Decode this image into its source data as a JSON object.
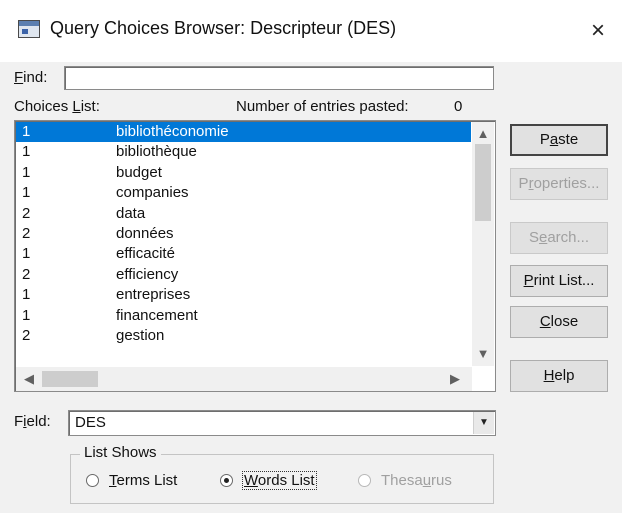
{
  "window": {
    "title": "Query Choices Browser: Descripteur (DES)",
    "close_glyph": "×"
  },
  "find": {
    "label_accel": "F",
    "label_rest": "ind:",
    "value": ""
  },
  "choices": {
    "label_pre": "Choices ",
    "label_accel": "L",
    "label_post": "ist:",
    "entries_pasted_label": "Number of entries pasted:",
    "entries_pasted_value": "0",
    "rows": [
      {
        "count": "1",
        "term": "bibliothéconomie",
        "selected": true
      },
      {
        "count": "1",
        "term": "bibliothèque"
      },
      {
        "count": "1",
        "term": "budget"
      },
      {
        "count": "1",
        "term": "companies"
      },
      {
        "count": "2",
        "term": "data"
      },
      {
        "count": "2",
        "term": "données"
      },
      {
        "count": "1",
        "term": "efficacité"
      },
      {
        "count": "2",
        "term": "efficiency"
      },
      {
        "count": "1",
        "term": "entreprises"
      },
      {
        "count": "1",
        "term": "financement"
      },
      {
        "count": "2",
        "term": "gestion"
      }
    ]
  },
  "buttons": {
    "paste": {
      "pre": "P",
      "accel": "a",
      "post": "ste"
    },
    "properties": {
      "pre": "P",
      "accel": "r",
      "post": "operties..."
    },
    "search": {
      "pre": "S",
      "accel": "e",
      "post": "arch..."
    },
    "print": {
      "pre": "",
      "accel": "P",
      "post": "rint List..."
    },
    "close": {
      "pre": "",
      "accel": "C",
      "post": "lose"
    },
    "help": {
      "pre": "",
      "accel": "H",
      "post": "elp"
    }
  },
  "field": {
    "label_pre": "F",
    "label_accel": "i",
    "label_post": "eld:",
    "value": "DES"
  },
  "list_shows": {
    "title": "List Shows",
    "options": [
      {
        "pre": "",
        "accel": "T",
        "post": "erms List",
        "selected": false,
        "enabled": true
      },
      {
        "pre": "",
        "accel": "W",
        "post": "ords List",
        "selected": true,
        "enabled": true
      },
      {
        "pre": "Thesa",
        "accel": "u",
        "post": "rus",
        "selected": false,
        "enabled": false
      }
    ]
  },
  "icons": [
    "app-icon",
    "close-icon",
    "scroll-up-icon",
    "scroll-down-icon",
    "scroll-left-icon",
    "scroll-right-icon",
    "dropdown-arrow-icon"
  ],
  "colors": {
    "selection": "#0078d7",
    "disabled_text": "#a0a0a0",
    "dialog_bg": "#f1f1f1"
  }
}
